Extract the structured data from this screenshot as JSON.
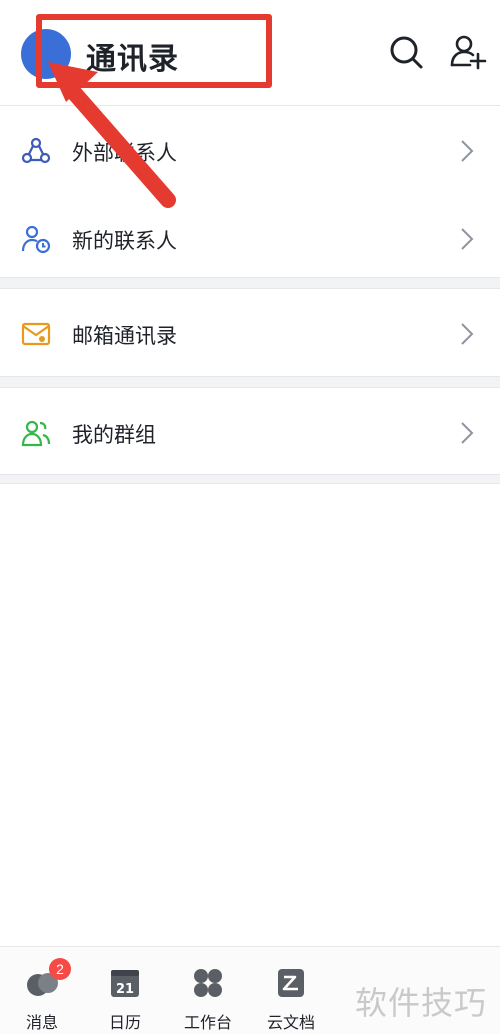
{
  "header": {
    "title": "通讯录"
  },
  "groups": [
    {
      "items": [
        {
          "label": "外部联系人",
          "icon": "external-contacts-icon"
        },
        {
          "label": "新的联系人",
          "icon": "new-contact-icon"
        }
      ]
    },
    {
      "items": [
        {
          "label": "邮箱通讯录",
          "icon": "mail-contacts-icon"
        }
      ]
    },
    {
      "items": [
        {
          "label": "我的群组",
          "icon": "group-icon"
        }
      ]
    }
  ],
  "tabbar": {
    "tabs": [
      {
        "label": "消息",
        "icon": "message-icon",
        "badge": "2"
      },
      {
        "label": "日历",
        "icon": "calendar-icon",
        "date": "21"
      },
      {
        "label": "工作台",
        "icon": "workbench-icon"
      },
      {
        "label": "云文档",
        "icon": "docs-icon"
      }
    ]
  },
  "watermark": "软件技巧",
  "colors": {
    "annotation": "#e53a30",
    "accent_blue": "#3b6fd8",
    "mail_orange": "#e79a1c",
    "group_green": "#34b64a",
    "badge_red": "#f54a45"
  }
}
